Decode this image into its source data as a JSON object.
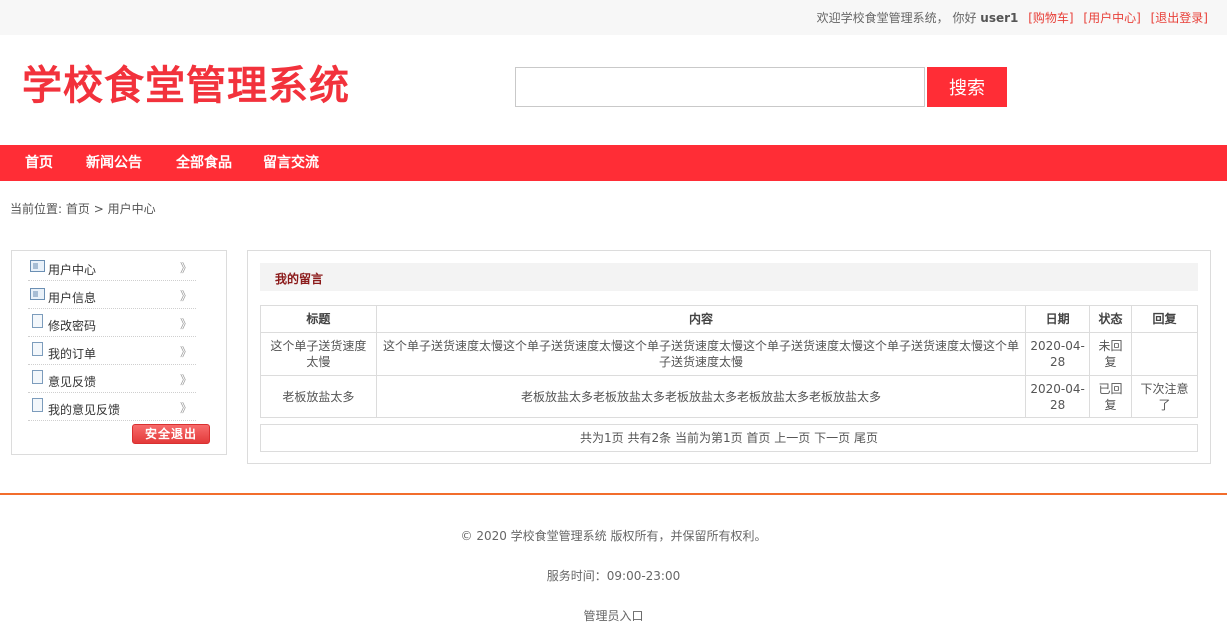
{
  "topbar": {
    "welcome": "欢迎学校食堂管理系统， 你好",
    "username": "user1",
    "links": [
      "[购物车]",
      "[用户中心]",
      "[退出登录]"
    ]
  },
  "logo": {
    "text": "学校食堂管理系统"
  },
  "search": {
    "value": "",
    "button": "搜索"
  },
  "nav": [
    "首页",
    "新闻公告",
    "全部食品",
    "留言交流"
  ],
  "breadcrumb": {
    "prefix": "当前位置: ",
    "home": "首页",
    "sep": " > ",
    "current": "用户中心"
  },
  "sidebar": {
    "items": [
      {
        "label": "用户中心",
        "icon": "id-card-icon"
      },
      {
        "label": "用户信息",
        "icon": "id-card-icon"
      },
      {
        "label": "修改密码",
        "icon": "document-icon"
      },
      {
        "label": "我的订单",
        "icon": "document-icon"
      },
      {
        "label": "意见反馈",
        "icon": "document-icon"
      },
      {
        "label": "我的意见反馈",
        "icon": "document-icon"
      }
    ],
    "chevron": "》",
    "logout": "安全退出"
  },
  "main": {
    "title": "我的留言",
    "headers": [
      "标题",
      "内容",
      "日期",
      "状态",
      "回复"
    ],
    "rows": [
      {
        "title": "这个单子送货速度太慢",
        "content": "这个单子送货速度太慢这个单子送货速度太慢这个单子送货速度太慢这个单子送货速度太慢这个单子送货速度太慢这个单子送货速度太慢",
        "date": "2020-04-28",
        "status": "未回复",
        "reply": ""
      },
      {
        "title": "老板放盐太多",
        "content": "老板放盐太多老板放盐太多老板放盐太多老板放盐太多老板放盐太多",
        "date": "2020-04-28",
        "status": "已回复",
        "reply": "下次注意了"
      }
    ],
    "pager": {
      "total_pages": "共为1页",
      "total_items": "共有2条",
      "current": "当前为第1页",
      "first": "首页",
      "prev": "上一页",
      "next": "下一页",
      "last": "尾页"
    }
  },
  "footer": {
    "copyright": "© 2020 学校食堂管理系统 版权所有，并保留所有权利。",
    "service": "服务时间：09:00-23:00",
    "admin": "管理员入口"
  },
  "colors": {
    "brand_red": "#ff2d36",
    "footer_line": "#f26d2c",
    "title_text": "#8b1a1a"
  }
}
